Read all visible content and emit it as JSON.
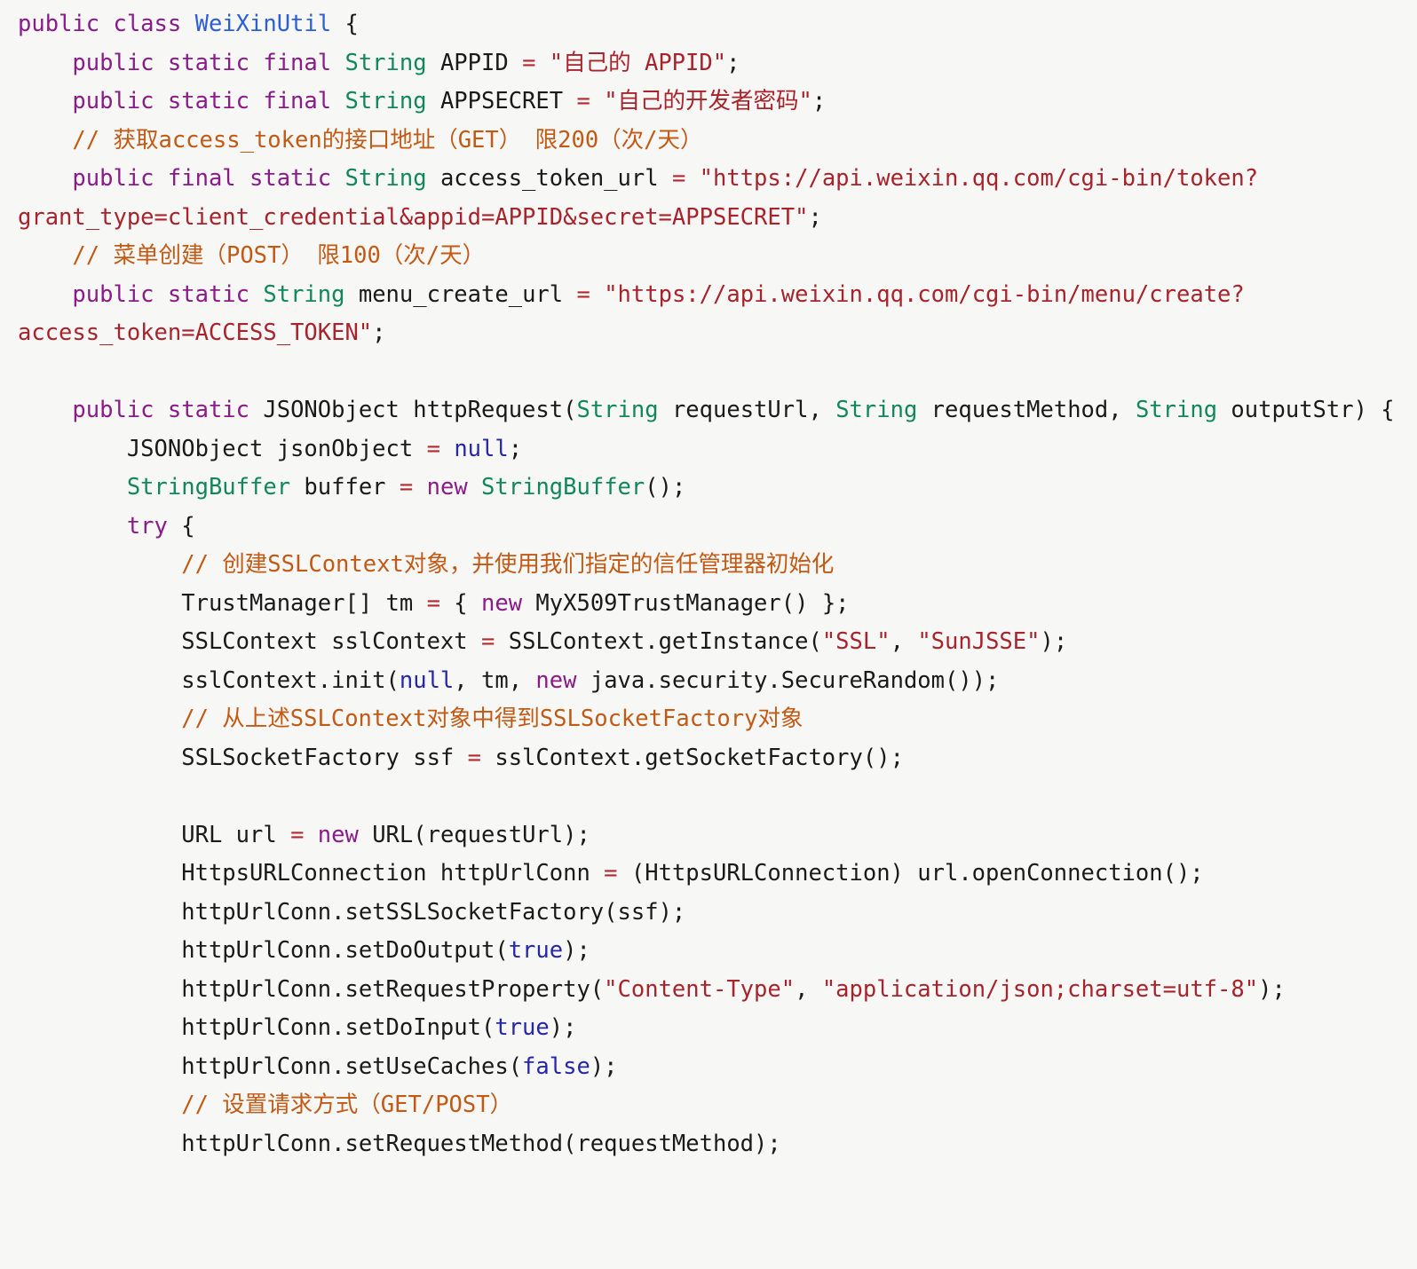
{
  "document": {
    "kind": "code-listing",
    "language": "Java",
    "class_name": "WeiXinUtil",
    "background_color": "#f7f7f5",
    "palette": {
      "keyword": "#8b1a8b",
      "type": "#11875c",
      "class_declaration": "#2b5fd9",
      "string": "#a8232b",
      "comment": "#c25a15",
      "operator": "#b4282e",
      "literal": "#2626a8",
      "plain": "#1a1a1a"
    }
  },
  "code": {
    "line_01": {
      "t1": "public class ",
      "t2": "WeiXinUtil",
      "t3": " {"
    },
    "line_02": {
      "indent": "    ",
      "kw": "public static final ",
      "type": "String",
      "name": " APPID ",
      "op": "=",
      "str": " \"自己的 APPID\"",
      "end": ";"
    },
    "line_03": {
      "indent": "    ",
      "kw": "public static final ",
      "type": "String",
      "name": " APPSECRET ",
      "op": "=",
      "str": " \"自己的开发者密码\"",
      "end": ";"
    },
    "line_04": {
      "indent": "    ",
      "comment": "// 获取access_token的接口地址（GET） 限200（次/天）"
    },
    "line_05": {
      "indent": "    ",
      "kw": "public final static ",
      "type": "String",
      "name": " access_token_url ",
      "op": "=",
      "str": " \"https://api.weixin.qq.com/cgi-bin/token?grant_type=client_credential&appid=APPID&secret=APPSECRET\"",
      "end": ";"
    },
    "line_06": {
      "indent": "    ",
      "comment": "// 菜单创建（POST） 限100（次/天）"
    },
    "line_07": {
      "indent": "    ",
      "kw": "public static ",
      "type": "String",
      "name": " menu_create_url ",
      "op": "=",
      "str": " \"https://api.weixin.qq.com/cgi-bin/menu/create?access_token=ACCESS_TOKEN\"",
      "end": ";"
    },
    "line_08": {
      "blank": ""
    },
    "line_09": {
      "indent": "    ",
      "kw": "public static ",
      "plain1": "JSONObject httpRequest(",
      "type1": "String",
      "plain2": " requestUrl, ",
      "type2": "String",
      "plain3": " requestMethod, ",
      "type3": "String",
      "plain4": " outputStr) {"
    },
    "line_10": {
      "indent": "        ",
      "plain1": "JSONObject jsonObject ",
      "op": "=",
      "plain2": " ",
      "lit": "null",
      "end": ";"
    },
    "line_11": {
      "indent": "        ",
      "type1": "StringBuffer",
      "plain1": " buffer ",
      "op": "=",
      "plain2": " ",
      "kw": "new",
      "plain3": " ",
      "type2": "StringBuffer",
      "end": "();"
    },
    "line_12": {
      "indent": "        ",
      "kw": "try",
      "plain": " {"
    },
    "line_13": {
      "indent": "            ",
      "comment": "// 创建SSLContext对象，并使用我们指定的信任管理器初始化"
    },
    "line_14": {
      "indent": "            ",
      "plain1": "TrustManager[] tm ",
      "op": "=",
      "plain2": " { ",
      "kw": "new",
      "plain3": " MyX509TrustManager() };"
    },
    "line_15": {
      "indent": "            ",
      "plain1": "SSLContext sslContext ",
      "op": "=",
      "plain2": " SSLContext.getInstance(",
      "str1": "\"SSL\"",
      "plain3": ", ",
      "str2": "\"SunJSSE\"",
      "end": ");"
    },
    "line_16": {
      "indent": "            ",
      "plain1": "sslContext.init(",
      "lit": "null",
      "plain2": ", tm, ",
      "kw": "new",
      "plain3": " java.security.SecureRandom());"
    },
    "line_17": {
      "indent": "            ",
      "comment": "// 从上述SSLContext对象中得到SSLSocketFactory对象"
    },
    "line_18": {
      "indent": "            ",
      "plain1": "SSLSocketFactory ssf ",
      "op": "=",
      "plain2": " sslContext.getSocketFactory();"
    },
    "line_19": {
      "blank": ""
    },
    "line_20": {
      "indent": "            ",
      "plain1": "URL url ",
      "op": "=",
      "plain2": " ",
      "kw": "new",
      "plain3": " URL(requestUrl);"
    },
    "line_21": {
      "indent": "            ",
      "plain1": "HttpsURLConnection httpUrlConn ",
      "op": "=",
      "plain2": " (HttpsURLConnection) url.openConnection();"
    },
    "line_22": {
      "indent": "            ",
      "plain": "httpUrlConn.setSSLSocketFactory(ssf);"
    },
    "line_23": {
      "indent": "            ",
      "plain1": "httpUrlConn.setDoOutput(",
      "lit": "true",
      "end": ");"
    },
    "line_24": {
      "indent": "            ",
      "plain1": "httpUrlConn.setRequestProperty(",
      "str1": "\"Content-Type\"",
      "plain2": ", ",
      "str2": "\"application/json;charset=utf-8\"",
      "end": ");"
    },
    "line_25": {
      "indent": "            ",
      "plain1": "httpUrlConn.setDoInput(",
      "lit": "true",
      "end": ");"
    },
    "line_26": {
      "indent": "            ",
      "plain1": "httpUrlConn.setUseCaches(",
      "lit": "false",
      "end": ");"
    },
    "line_27": {
      "indent": "            ",
      "comment": "// 设置请求方式（GET/POST）"
    },
    "line_28": {
      "indent": "            ",
      "plain": "httpUrlConn.setRequestMethod(requestMethod);"
    }
  }
}
